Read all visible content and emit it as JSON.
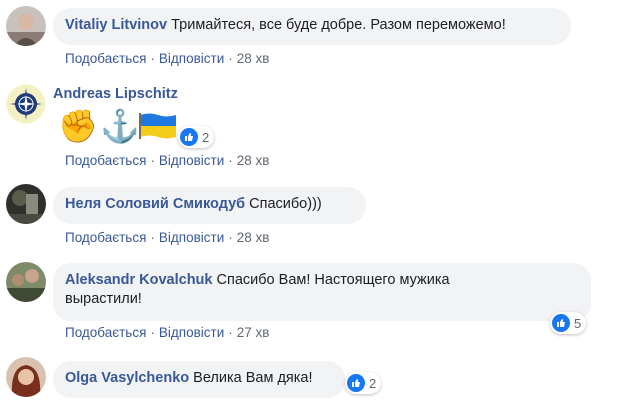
{
  "comments": [
    {
      "name": "Vitaliy Litvinov",
      "text": "Тримайтеся, все буде добре. Разом переможемо!",
      "like": "Подобається",
      "reply": "Відповісти",
      "time": "28 хв"
    },
    {
      "name": "Andreas Lipschitz",
      "emoji": [
        "✊",
        "⚓",
        "ukraine-flag"
      ],
      "reactions": "2",
      "like": "Подобається",
      "reply": "Відповісти",
      "time": "28 хв"
    },
    {
      "name": "Неля Соловий Смикодуб",
      "text": "Спасибо)))",
      "like": "Подобається",
      "reply": "Відповісти",
      "time": "28 хв"
    },
    {
      "name": "Aleksandr Kovalchuk",
      "text_line1": "Спасибо Вам! Настоящего мужика",
      "text_line2": "вырастили!",
      "reactions": "5",
      "like": "Подобається",
      "reply": "Відповісти",
      "time": "27 хв"
    },
    {
      "name": "Olga Vasylchenko",
      "text": "Велика Вам дяка!",
      "reactions": "2"
    }
  ],
  "colors": {
    "name": "#385898",
    "bubble": "#f2f3f5",
    "like_icon": "#1877f2",
    "meta": "#606770"
  }
}
